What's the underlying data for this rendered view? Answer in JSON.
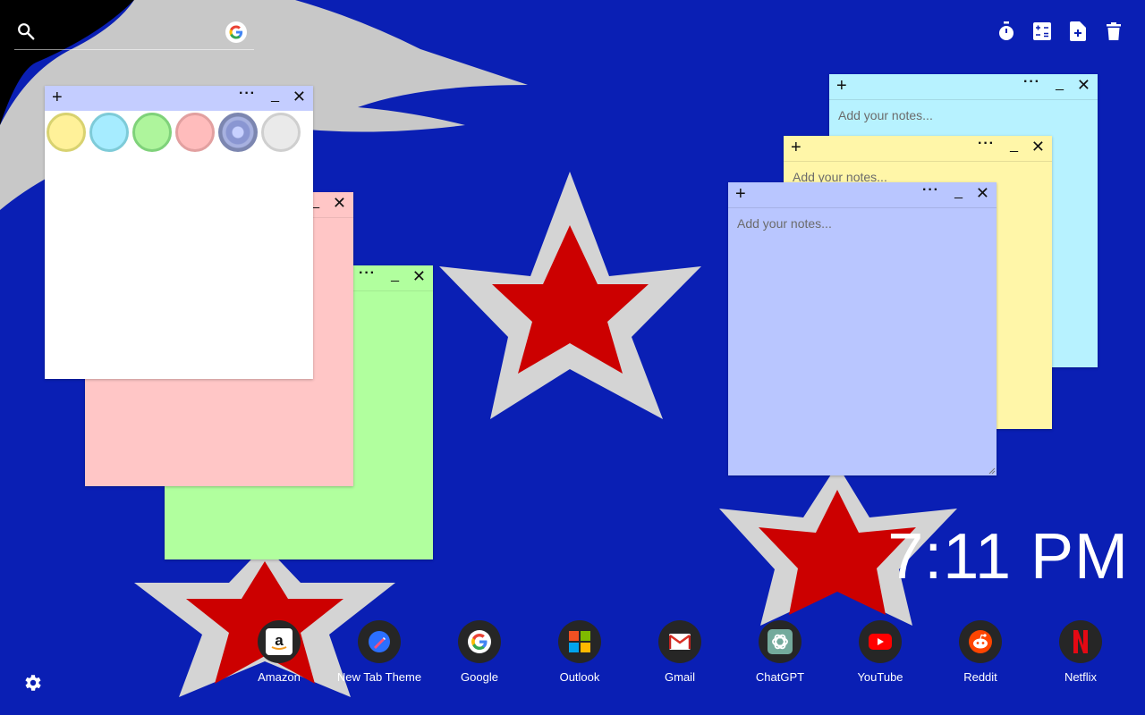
{
  "search": {
    "placeholder": "",
    "value": ""
  },
  "toolbar": {
    "icons": [
      "timer-icon",
      "calculator-icon",
      "add-note-icon",
      "trash-icon"
    ]
  },
  "notes": {
    "placeholder": "Add your notes...",
    "colors": {
      "blue": "#b9c6ff",
      "yellow": "#fff6a8",
      "cyan": "#b7f2ff",
      "pink": "#ffc6c6",
      "green": "#b1ff9e",
      "white": "#ffffff"
    },
    "swatch_colors": [
      "#fff199",
      "#a6ecff",
      "#aef59c",
      "#ffbcbc",
      "#8c98c6",
      "#eaeaea"
    ]
  },
  "clock": {
    "time": "7:11 PM"
  },
  "shortcuts": [
    {
      "label": "Amazon",
      "icon": "amazon-icon"
    },
    {
      "label": "New Tab Theme",
      "icon": "new-tab-theme-icon"
    },
    {
      "label": "Google",
      "icon": "google-icon"
    },
    {
      "label": "Outlook",
      "icon": "outlook-icon"
    },
    {
      "label": "Gmail",
      "icon": "gmail-icon"
    },
    {
      "label": "ChatGPT",
      "icon": "chatgpt-icon"
    },
    {
      "label": "YouTube",
      "icon": "youtube-icon"
    },
    {
      "label": "Reddit",
      "icon": "reddit-icon"
    },
    {
      "label": "Netflix",
      "icon": "netflix-icon"
    }
  ],
  "background": {
    "main": "#0a1fb4",
    "star_red": "#cc0000",
    "star_border": "#d4d4d4"
  }
}
